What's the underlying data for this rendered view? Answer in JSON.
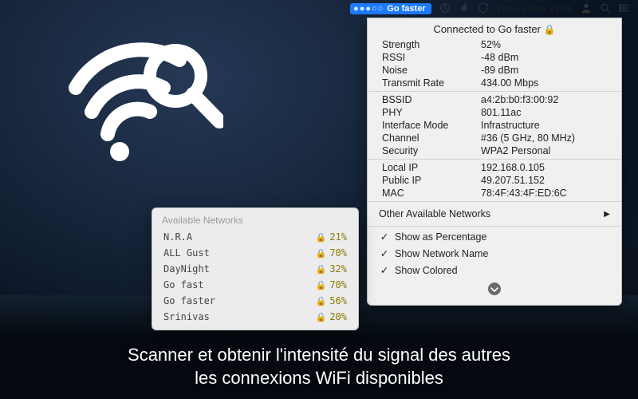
{
  "menubar": {
    "app_pill_label": "Go faster",
    "app_pill_dots": "●●●○○",
    "datetime": "Thu 24 Nov  21:34"
  },
  "panel": {
    "connected_prefix": "Connected to ",
    "connected_network": "Go faster",
    "signal": [
      {
        "k": "Strength",
        "v": "52%"
      },
      {
        "k": "RSSI",
        "v": "-48 dBm"
      },
      {
        "k": "Noise",
        "v": "-89 dBm"
      },
      {
        "k": "Transmit Rate",
        "v": "434.00 Mbps"
      }
    ],
    "radio": [
      {
        "k": "BSSID",
        "v": "a4:2b:b0:f3:00:92"
      },
      {
        "k": "PHY",
        "v": "801.11ac"
      },
      {
        "k": "Interface Mode",
        "v": "Infrastructure"
      },
      {
        "k": "Channel",
        "v": "#36 (5 GHz, 80 MHz)"
      },
      {
        "k": "Security",
        "v": "WPA2 Personal"
      }
    ],
    "ip": [
      {
        "k": "Local IP",
        "v": "192.168.0.105"
      },
      {
        "k": "Public IP",
        "v": "49.207.51.152"
      },
      {
        "k": "MAC",
        "v": "78:4F:43:4F:ED:6C"
      }
    ],
    "other_label": "Other Available Networks",
    "opts": {
      "percentage": "Show as Percentage",
      "name": "Show Network Name",
      "colored": "Show Colored"
    },
    "checkmark": "✓"
  },
  "networks": {
    "title": "Available Networks",
    "rows": [
      {
        "name": "N.R.A",
        "pct": "21%"
      },
      {
        "name": "ALL Gust",
        "pct": "70%"
      },
      {
        "name": "DayNight",
        "pct": "32%"
      },
      {
        "name": "Go fast",
        "pct": "70%"
      },
      {
        "name": "Go faster",
        "pct": "56%"
      },
      {
        "name": "Srinivas",
        "pct": "20%"
      }
    ]
  },
  "caption": {
    "line1": "Scanner et obtenir l'intensité du signal des autres",
    "line2": "les connexions WiFi disponibles"
  },
  "icons": {
    "lock": "🔒",
    "triangle_right": "▶",
    "chevron_down": "⌄"
  }
}
